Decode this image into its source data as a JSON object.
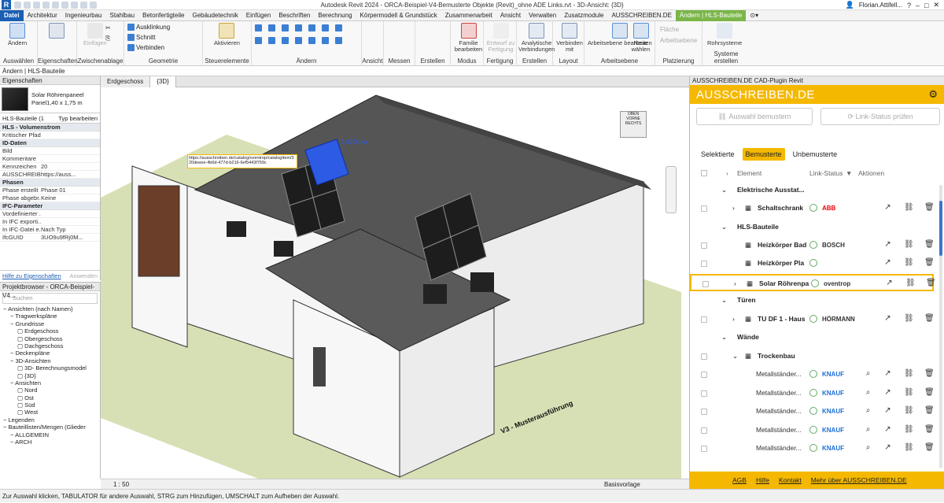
{
  "window": {
    "title": "Autodesk Revit 2024 - ORCA-Beispiel-V4-Bemusterte Objekte (Revit)_ohne ADE Links.rvt - 3D-Ansicht: {3D}",
    "user": "Florian.Attifell..."
  },
  "menu": {
    "tabs": [
      "Datei",
      "Architektur",
      "Ingenieurbau",
      "Stahlbau",
      "Betonfertigteile",
      "Gebäudetechnik",
      "Einfügen",
      "Beschriften",
      "Berechnung",
      "Körpermodell & Grundstück",
      "Zusammenarbeit",
      "Ansicht",
      "Verwalten",
      "Zusatzmodule",
      "AUSSCHREIBEN.DE",
      "Ändern | HLS-Bauteile"
    ]
  },
  "ribbon": {
    "groups": [
      "Auswählen",
      "Eigenschaften",
      "Zwischenablage",
      "Geometrie",
      "Steuerelemente",
      "Ändern",
      "Ansicht",
      "Messen",
      "Erstellen",
      "Modus",
      "Fertigung",
      "Erstellen",
      "Layout",
      "Arbeitsebene",
      "Platzierung",
      "Systeme erstellen"
    ],
    "buttons": {
      "aendern": "Ändern",
      "einfuegen": "Einfügen",
      "ausklinkung": "Ausklinkung",
      "schnitt": "Schnitt",
      "verbinden": "Verbinden",
      "aktivieren": "Aktivieren",
      "familie": "Familie bearbeiten",
      "entwurf": "Entwurf zu Fertigung",
      "analytische": "Analytische Verbindungen",
      "verbinden_mit": "Verbinden mit",
      "arbeitsebene": "Arbeitsebene bearbeiten",
      "neue": "Neue wählen",
      "flaeche": "Fläche",
      "arbeitsebene2": "Arbeitsebene",
      "rohrsysteme": "Rohrsysteme"
    }
  },
  "options_bar": "Ändern | HLS-Bauteile",
  "properties": {
    "title": "Eigenschaften",
    "type_name": "Solar Röhrenpaneel",
    "type_size": "Panel1,40 x 1,75 m",
    "filter": "HLS-Bauteile (1",
    "edit_type": "Typ bearbeiten",
    "rows": [
      {
        "k": "HLS - Volumenstrom",
        "v": "",
        "sec": true
      },
      {
        "k": "Kritischer Pfad",
        "v": ""
      },
      {
        "k": "ID-Daten",
        "v": "",
        "sec": true
      },
      {
        "k": "Bild",
        "v": ""
      },
      {
        "k": "Kommentare",
        "v": ""
      },
      {
        "k": "Kennzeichen",
        "v": "20"
      },
      {
        "k": "AUSSCHREIBE...",
        "v": "https://auss..."
      },
      {
        "k": "Phasen",
        "v": "",
        "sec": true
      },
      {
        "k": "Phase erstellt",
        "v": "Phase 01"
      },
      {
        "k": "Phase abgebr...",
        "v": "Keine"
      },
      {
        "k": "IFC-Parameter",
        "v": "",
        "sec": true
      },
      {
        "k": "Vordefinierter ...",
        "v": ""
      },
      {
        "k": "In IFC exporti...",
        "v": ""
      },
      {
        "k": "In IFC-Datei e...",
        "v": "Nach Typ"
      },
      {
        "k": "IfcGUID",
        "v": "3UO9u9fRj0M..."
      }
    ],
    "help": "Hilfe zu Eigenschaften",
    "apply": "Anwenden"
  },
  "browser": {
    "title": "Projektbrowser - ORCA-Beispiel-V4...",
    "search": "Suchen",
    "nodes": [
      {
        "t": "Ansichten (nach Namen)",
        "d": 0
      },
      {
        "t": "Tragwerkspläne",
        "d": 1
      },
      {
        "t": "Grundrisse",
        "d": 1
      },
      {
        "t": "Erdgeschoss",
        "d": 2
      },
      {
        "t": "Obergeschoss",
        "d": 2
      },
      {
        "t": "Dachgeschoss",
        "d": 2
      },
      {
        "t": "Deckenpläne",
        "d": 1
      },
      {
        "t": "3D-Ansichten",
        "d": 1
      },
      {
        "t": "3D- Berechnungsmodel",
        "d": 2
      },
      {
        "t": "{3D}",
        "d": 2
      },
      {
        "t": "Ansichten",
        "d": 1
      },
      {
        "t": "Nord",
        "d": 2
      },
      {
        "t": "Ost",
        "d": 2
      },
      {
        "t": "Süd",
        "d": 2
      },
      {
        "t": "West",
        "d": 2
      },
      {
        "t": "Legenden",
        "d": 0
      },
      {
        "t": "Bauteillisten/Mengen (Glieder",
        "d": 0
      },
      {
        "t": "ALLGEMEIN",
        "d": 1
      },
      {
        "t": "ARCH",
        "d": 1
      }
    ]
  },
  "view_tabs": [
    "Erdgeschoss",
    "{3D}"
  ],
  "viewport": {
    "tooltip": "https://ausschreiben.de/catalog/oventrop/catalogItem/320deeee-4b6d-477d-b216-6ef5443f759c",
    "dim": "2,0200 m",
    "facade_text": "V3 - Musterausführung",
    "cube": {
      "top": "OBEN",
      "front": "VORNE",
      "right": "RECHTS"
    }
  },
  "view_status": {
    "scale": "1 : 50",
    "basis": "Basisvorlage"
  },
  "status_bar": "Zur Auswahl klicken, TABULATOR für andere Auswahl, STRG zum Hinzufügen, UMSCHALT zum Aufheben der Auswahl.",
  "plugin": {
    "panel_title": "AUSSCHREIBEN.DE CAD-Plugin Revit",
    "brand": "AUSSCHREIBEN.DE",
    "btn_sample": "Auswahl bemustern",
    "btn_link": "Link-Status prüfen",
    "tabs": [
      "Selektierte",
      "Bemusterte",
      "Unbemusterte"
    ],
    "columns": {
      "element": "Element",
      "link": "Link-Status",
      "actions": "Aktionen"
    },
    "rows": [
      {
        "kind": "group",
        "label": "Elektrische Ausstat..."
      },
      {
        "kind": "item",
        "label": "Schaltschrank",
        "brand": "ABB",
        "arrow": true
      },
      {
        "kind": "group",
        "label": "HLS-Bauteile"
      },
      {
        "kind": "item",
        "label": "Heizkörper Bad",
        "brand": "BOSCH",
        "arrow": false
      },
      {
        "kind": "item",
        "label": "Heizkörper Pla",
        "brand": "",
        "arrow": false
      },
      {
        "kind": "item",
        "label": "Solar Röhrenpa",
        "brand": "oventrop",
        "arrow": true,
        "hl": true
      },
      {
        "kind": "group",
        "label": "Türen"
      },
      {
        "kind": "item",
        "label": "TU DF 1 - Haus",
        "brand": "HÖRMANN",
        "arrow": true
      },
      {
        "kind": "group",
        "label": "Wände"
      },
      {
        "kind": "sub",
        "label": "Trockenbau"
      },
      {
        "kind": "leaf",
        "label": "Metallständer...",
        "brand": "KNAUF"
      },
      {
        "kind": "leaf",
        "label": "Metallständer...",
        "brand": "KNAUF"
      },
      {
        "kind": "leaf",
        "label": "Metallständer...",
        "brand": "KNAUF"
      },
      {
        "kind": "leaf",
        "label": "Metallständer...",
        "brand": "KNAUF"
      },
      {
        "kind": "leaf",
        "label": "Metallständer...",
        "brand": "KNAUF"
      }
    ],
    "footer": [
      "AGB",
      "Hilfe",
      "Kontakt",
      "Mehr über AUSSCHREIBEN.DE"
    ]
  },
  "colors": {
    "accent": "#f5b800",
    "revit_blue": "#1a5fb4",
    "context_green": "#7ab648"
  }
}
